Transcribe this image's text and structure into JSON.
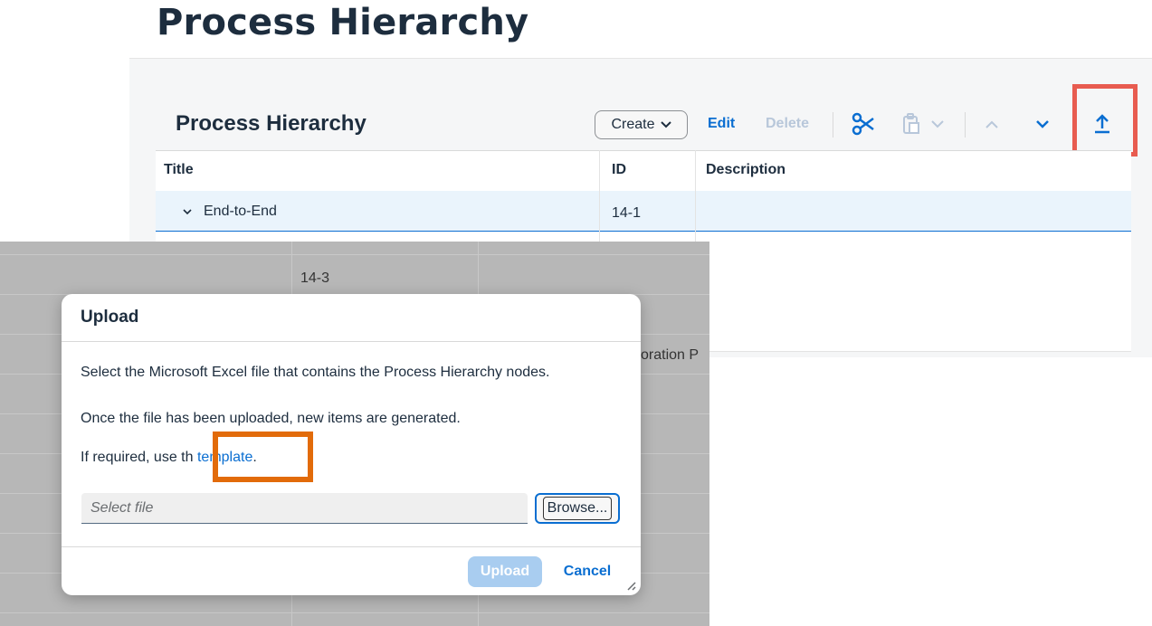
{
  "page": {
    "title": "Process Hierarchy"
  },
  "panel": {
    "title": "Process Hierarchy",
    "toolbar": {
      "create_label": "Create",
      "edit_label": "Edit",
      "delete_label": "Delete"
    },
    "columns": [
      "Title",
      "ID",
      "Description"
    ],
    "rows": [
      {
        "title": "End-to-End",
        "id": "14-1",
        "description": "",
        "expanded": true,
        "selected": true
      }
    ]
  },
  "background": {
    "row_id": "14-3",
    "partial_text": "oration P"
  },
  "dialog": {
    "title": "Upload",
    "line1": "Select the Microsoft Excel file that contains the Process Hierarchy nodes.",
    "line2": "Once the file has been uploaded, new items are generated.",
    "line3_prefix": "If required, use th",
    "line3_link": "template",
    "line3_suffix": ".",
    "file_placeholder": "Select file",
    "browse_label": "Browse...",
    "upload_label": "Upload",
    "cancel_label": "Cancel"
  },
  "colors": {
    "accent": "#0a6ed1",
    "highlight_red": "#e85c50",
    "highlight_orange": "#e26b0a"
  }
}
